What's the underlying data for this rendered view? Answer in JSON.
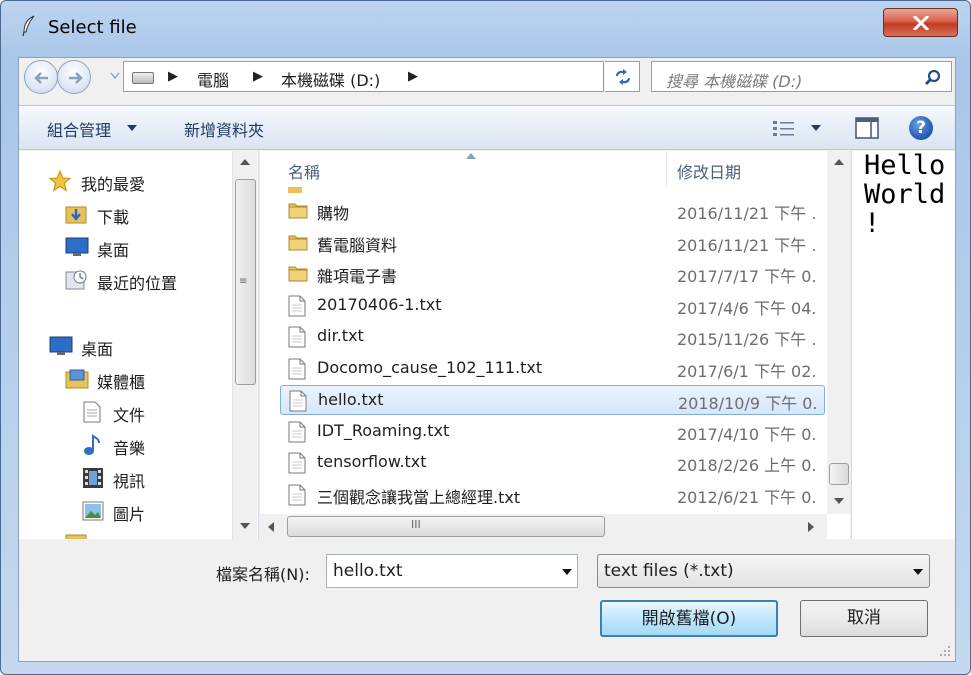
{
  "window": {
    "title": "Select file"
  },
  "address": {
    "crumbs": [
      "電腦",
      "本機磁碟 (D:)"
    ],
    "search_placeholder": "搜尋 本機磁碟 (D:)"
  },
  "toolbar": {
    "organize": "組合管理",
    "new_folder": "新增資料夾"
  },
  "navpane": {
    "items": [
      {
        "label": "我的最愛",
        "icon": "star-icon"
      },
      {
        "label": "下載",
        "icon": "downloads-folder-icon"
      },
      {
        "label": "桌面",
        "icon": "desktop-icon"
      },
      {
        "label": "最近的位置",
        "icon": "recent-places-icon"
      },
      {
        "label": "桌面",
        "icon": "desktop-icon"
      },
      {
        "label": "媒體櫃",
        "icon": "libraries-icon"
      },
      {
        "label": "文件",
        "icon": "documents-icon"
      },
      {
        "label": "音樂",
        "icon": "music-icon"
      },
      {
        "label": "視訊",
        "icon": "video-icon"
      },
      {
        "label": "圖片",
        "icon": "pictures-icon"
      }
    ]
  },
  "filelist": {
    "columns": {
      "name": "名稱",
      "date": "修改日期"
    },
    "rows": [
      {
        "name": "購物",
        "date": "2016/11/21 下午 .",
        "type": "folder"
      },
      {
        "name": "舊電腦資料",
        "date": "2016/11/21 下午 .",
        "type": "folder"
      },
      {
        "name": "雜項電子書",
        "date": "2017/7/17 下午 0.",
        "type": "folder"
      },
      {
        "name": "20170406-1.txt",
        "date": "2017/4/6 下午 04.",
        "type": "file"
      },
      {
        "name": "dir.txt",
        "date": "2015/11/26 下午 .",
        "type": "file"
      },
      {
        "name": "Docomo_cause_102_111.txt",
        "date": "2017/6/1 下午 02.",
        "type": "file"
      },
      {
        "name": "hello.txt",
        "date": "2018/10/9 下午 0.",
        "type": "file",
        "selected": true
      },
      {
        "name": "IDT_Roaming.txt",
        "date": "2017/4/10 下午 0.",
        "type": "file"
      },
      {
        "name": "tensorflow.txt",
        "date": "2018/2/26 上午 0.",
        "type": "file"
      },
      {
        "name": "三個觀念讓我當上總經理.txt",
        "date": "2012/6/21 下午 0.",
        "type": "file"
      }
    ]
  },
  "preview": {
    "text": "Hello\nWorld\n!"
  },
  "footer": {
    "filename_label": "檔案名稱(N):",
    "filename_value": "hello.txt",
    "filetype_value": "text files (*.txt)",
    "open_label": "開啟舊檔(O)",
    "cancel_label": "取消"
  }
}
